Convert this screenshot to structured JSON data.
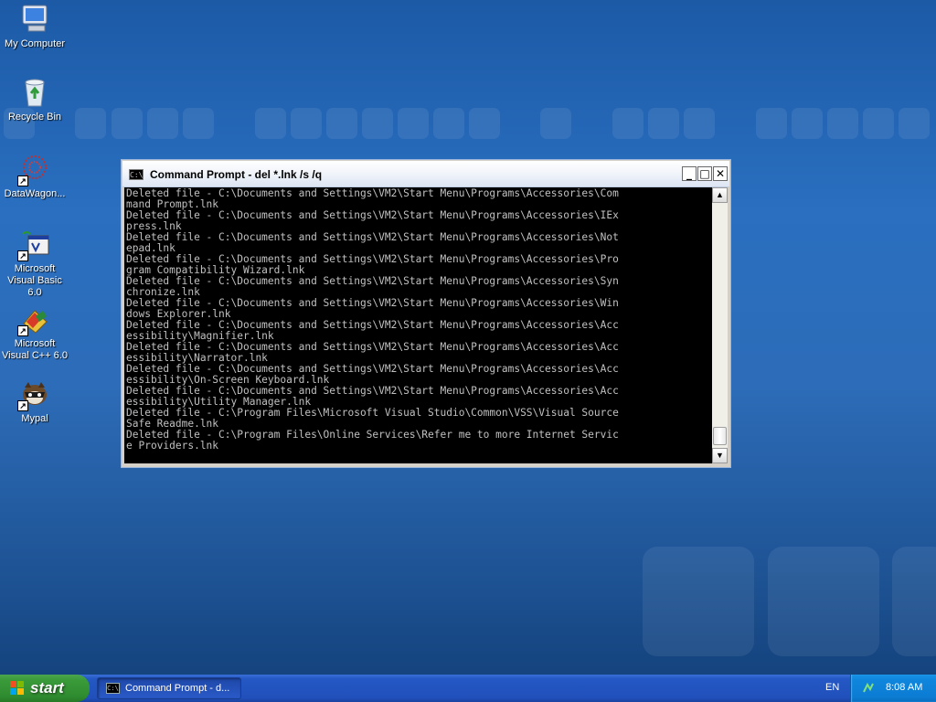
{
  "desktop": {
    "icons": [
      {
        "label": "My Computer",
        "icon": "computer-icon"
      },
      {
        "label": "Recycle Bin",
        "icon": "recycle-bin-icon"
      },
      {
        "label": "DataWagon...",
        "icon": "datawagon-icon"
      },
      {
        "label": "Microsoft Visual Basic 6.0",
        "icon": "visual-basic-icon"
      },
      {
        "label": "Microsoft Visual C++ 6.0",
        "icon": "visual-cpp-icon"
      },
      {
        "label": "Mypal",
        "icon": "mypal-icon"
      }
    ]
  },
  "window": {
    "title": "Command Prompt - del *.lnk /s /q",
    "icon_text": "C:\\",
    "minimize_glyph": "_",
    "maximize_glyph": "□",
    "close_glyph": "✕",
    "console_lines": [
      "Deleted file - C:\\Documents and Settings\\VM2\\Start Menu\\Programs\\Accessories\\Com",
      "mand Prompt.lnk",
      "Deleted file - C:\\Documents and Settings\\VM2\\Start Menu\\Programs\\Accessories\\IEx",
      "press.lnk",
      "Deleted file - C:\\Documents and Settings\\VM2\\Start Menu\\Programs\\Accessories\\Not",
      "epad.lnk",
      "Deleted file - C:\\Documents and Settings\\VM2\\Start Menu\\Programs\\Accessories\\Pro",
      "gram Compatibility Wizard.lnk",
      "Deleted file - C:\\Documents and Settings\\VM2\\Start Menu\\Programs\\Accessories\\Syn",
      "chronize.lnk",
      "Deleted file - C:\\Documents and Settings\\VM2\\Start Menu\\Programs\\Accessories\\Win",
      "dows Explorer.lnk",
      "Deleted file - C:\\Documents and Settings\\VM2\\Start Menu\\Programs\\Accessories\\Acc",
      "essibility\\Magnifier.lnk",
      "Deleted file - C:\\Documents and Settings\\VM2\\Start Menu\\Programs\\Accessories\\Acc",
      "essibility\\Narrator.lnk",
      "Deleted file - C:\\Documents and Settings\\VM2\\Start Menu\\Programs\\Accessories\\Acc",
      "essibility\\On-Screen Keyboard.lnk",
      "Deleted file - C:\\Documents and Settings\\VM2\\Start Menu\\Programs\\Accessories\\Acc",
      "essibility\\Utility Manager.lnk",
      "Deleted file - C:\\Program Files\\Microsoft Visual Studio\\Common\\VSS\\Visual Source",
      "Safe Readme.lnk",
      "Deleted file - C:\\Program Files\\Online Services\\Refer me to more Internet Servic",
      "e Providers.lnk"
    ],
    "colors": {
      "console_bg": "#000000",
      "console_text": "#c0c0c0"
    }
  },
  "taskbar": {
    "start_label": "start",
    "task_button_label": "Command Prompt - d...",
    "language": "EN",
    "clock": "8:08 AM"
  }
}
